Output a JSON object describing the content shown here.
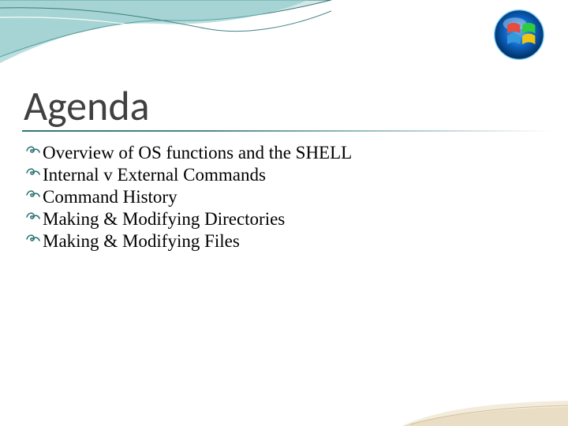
{
  "title": "Agenda",
  "bullets": [
    "Overview of OS functions and the SHELL",
    "Internal v External Commands",
    "Command History",
    "Making & Modifying Directories",
    "Making & Modifying Files"
  ]
}
